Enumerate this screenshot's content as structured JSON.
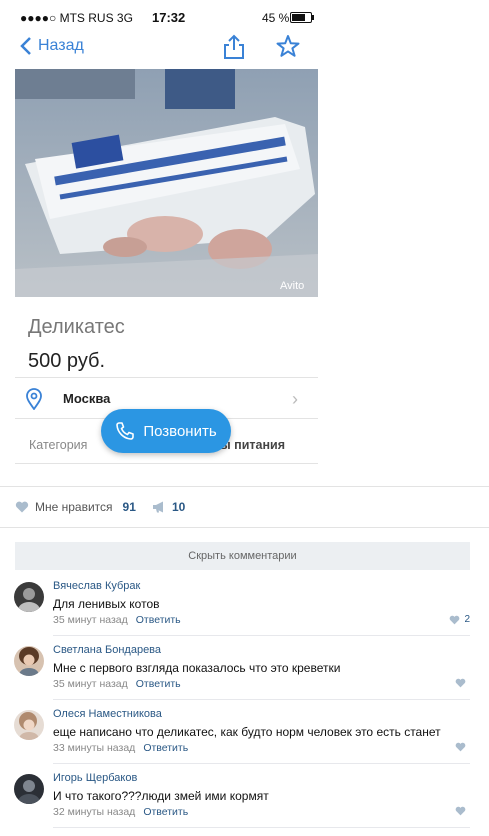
{
  "status_bar": {
    "carrier": "●●●●○ MTS RUS   3G",
    "time": "17:32",
    "battery": "45 %"
  },
  "nav": {
    "back_label": "Назад"
  },
  "listing": {
    "photo_watermark": "Avito",
    "title": "Деликатес",
    "price": "500 руб.",
    "location": "Москва",
    "category_label": "Категория",
    "category_value": "ы питания"
  },
  "call_button": {
    "label": "Позвонить"
  },
  "post_stats": {
    "likes_label": "Мне нравится",
    "likes_count": "91",
    "reposts_count": "10"
  },
  "comments_toggle": "Скрыть комментарии",
  "comments": [
    {
      "author": "Вячеслав Кубрак",
      "text": "Для ленивых котов",
      "time": "35 минут назад",
      "reply": "Ответить",
      "likes": "2"
    },
    {
      "author": "Светлана Бондарева",
      "text": "Мне с первого взгляда показалось что это креветки",
      "time": "35 минут назад",
      "reply": "Ответить",
      "likes": ""
    },
    {
      "author": "Олеся Наместникова",
      "text": "еще написано что деликатес, как будто норм человек это есть станет",
      "time": "33 минуты назад",
      "reply": "Ответить",
      "likes": ""
    },
    {
      "author": "Игорь Щербаков",
      "text": "И что такого???люди змей ими кормят",
      "time": "32 минуты назад",
      "reply": "Ответить",
      "likes": ""
    }
  ],
  "colors": {
    "accent": "#3a82d6",
    "call_button": "#2b96e3",
    "link": "#2a5885"
  }
}
